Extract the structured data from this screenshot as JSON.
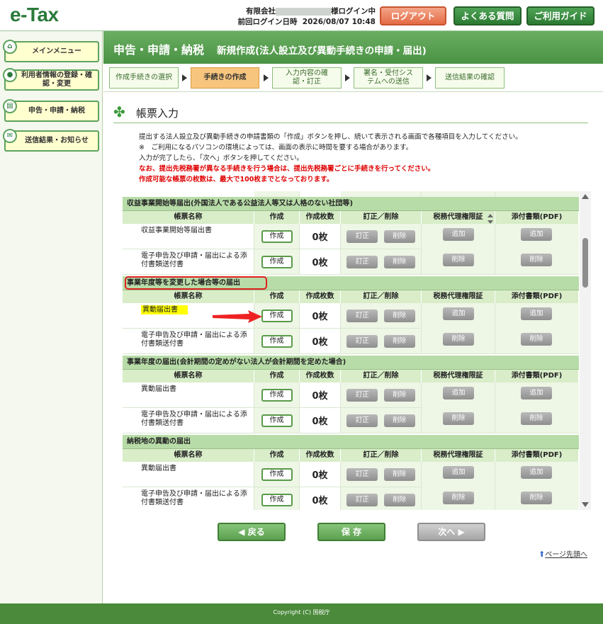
{
  "header": {
    "logo": "e-Tax",
    "company_prefix": "有限会社",
    "login_suffix": "様ログイン中",
    "last_login_label": "前回ログイン日時",
    "last_login_value": "2026/08/07 10:48",
    "logout": "ログアウト",
    "faq": "よくある質問",
    "guide": "ご利用ガイド"
  },
  "sidebar": {
    "items": [
      {
        "label": "メインメニュー"
      },
      {
        "label": "利用者情報の登録・確認・変更"
      },
      {
        "label": "申告・申請・納税"
      },
      {
        "label": "送信結果・お知らせ"
      }
    ]
  },
  "title": {
    "main": "申告・申請・納税",
    "sub": "新規作成(法人設立及び異動手続きの申請・届出)"
  },
  "steps": [
    {
      "label": "作成手続きの選択"
    },
    {
      "label": "手続きの作成"
    },
    {
      "label": "入力内容の確認・訂正"
    },
    {
      "label": "署名・受付システムへの送信"
    },
    {
      "label": "送信結果の確認"
    }
  ],
  "section": {
    "title": "帳票入力"
  },
  "notes": {
    "line1": "提出する法人設立及び異動手続きの申請書類の「作成」ボタンを押し、続いて表示される画面で各種項目を入力してください。",
    "line2": "※　ご利用になるパソコンの環境によっては、画面の表示に時間を要する場合があります。",
    "line3": "入力が完了したら、「次へ」ボタンを押してください。",
    "line4": "なお、提出先税務署が異なる手続きを行う場合は、提出先税務署ごとに手続きを行ってください。",
    "line5": "作成可能な帳票の枚数は、最大で100枚までとなっております。"
  },
  "table": {
    "headers": {
      "name": "帳票名称",
      "make": "作成",
      "count": "作成枚数",
      "edit": "訂正／削除",
      "agent": "税務代理権限証",
      "attach": "添付書類(PDF)"
    },
    "buttons": {
      "make": "作成",
      "correct": "訂正",
      "delete": "削除",
      "add": "追加"
    },
    "groups": [
      {
        "title": "収益事業開始等届出(外国法人である公益法人等又は人格のない社団等)",
        "rows": [
          {
            "name": "収益事業開始等届出書",
            "count": "0枚"
          },
          {
            "name": "電子申告及び申請・届出による添付書類送付書",
            "count": "0枚"
          }
        ]
      },
      {
        "title": "事業年度等を変更した場合等の届出",
        "rows": [
          {
            "name": "異動届出書",
            "count": "0枚"
          },
          {
            "name": "電子申告及び申請・届出による添付書類送付書",
            "count": "0枚"
          }
        ]
      },
      {
        "title": "事業年度の届出(会計期間の定めがない法人が会計期間を定めた場合)",
        "rows": [
          {
            "name": "異動届出書",
            "count": "0枚"
          },
          {
            "name": "電子申告及び申請・届出による添付書類送付書",
            "count": "0枚"
          }
        ]
      },
      {
        "title": "納税地の異動の届出",
        "rows": [
          {
            "name": "異動届出書",
            "count": "0枚"
          },
          {
            "name": "電子申告及び申請・届出による添付書類送付書",
            "count": "0枚"
          }
        ]
      }
    ]
  },
  "nav": {
    "back": "戻る",
    "save": "保 存",
    "next": "次へ",
    "page_top": "ページ先頭へ"
  },
  "footer": {
    "copyright": "Copyright (C) 国税庁"
  },
  "colors": {
    "brand_green": "#4a9244",
    "active_step": "#f7c57e",
    "warning_red": "#e00000",
    "highlight_yellow": "#ffff00"
  }
}
